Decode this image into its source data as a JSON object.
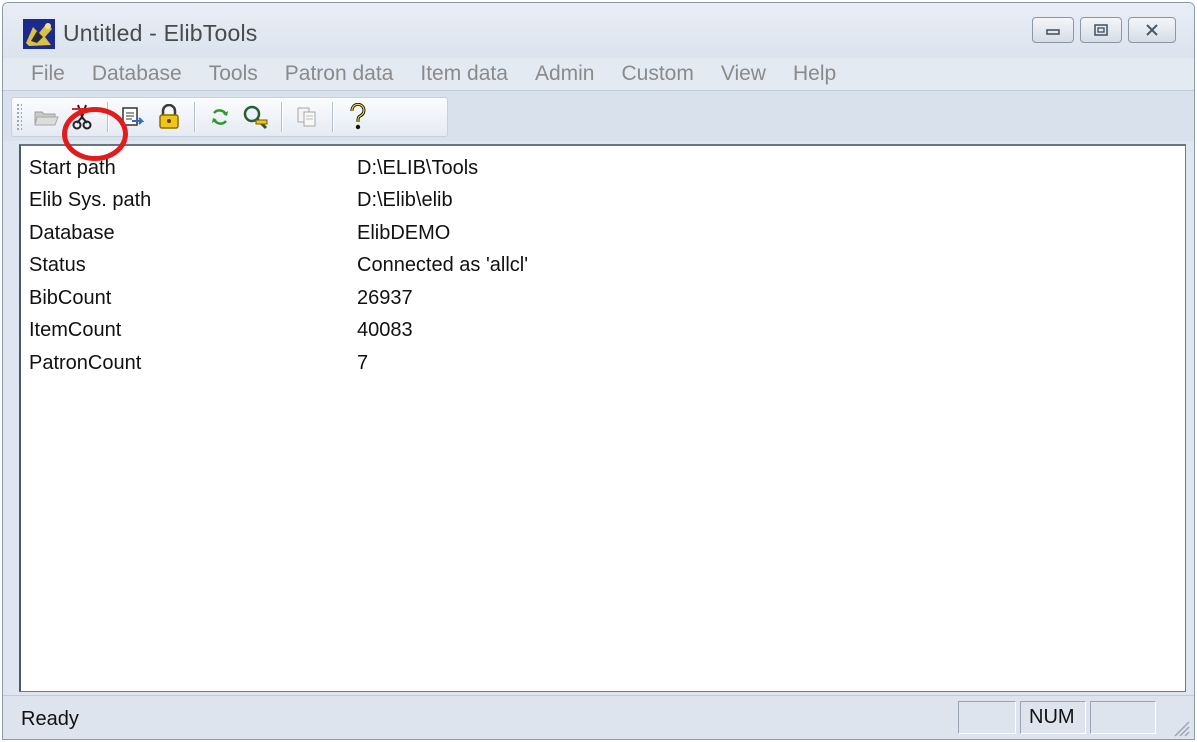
{
  "window": {
    "title": "Untitled - ElibTools",
    "icon": "elibtools-app-icon",
    "controls": [
      "minimize-icon",
      "maximize-icon",
      "close-icon"
    ]
  },
  "menu": [
    {
      "label": "File"
    },
    {
      "label": "Database"
    },
    {
      "label": "Tools"
    },
    {
      "label": "Patron data"
    },
    {
      "label": "Item data"
    },
    {
      "label": "Admin"
    },
    {
      "label": "Custom"
    },
    {
      "label": "View"
    },
    {
      "label": "Help"
    }
  ],
  "toolbar": {
    "buttons": [
      {
        "icon": "open-folder-icon",
        "enabled": false
      },
      {
        "icon": "disconnect-icon",
        "enabled": true,
        "highlighted": true
      },
      {
        "icon": "export-icon",
        "enabled": true
      },
      {
        "icon": "lock-icon",
        "enabled": true
      },
      {
        "icon": "refresh-icon",
        "enabled": true
      },
      {
        "icon": "search-keys-icon",
        "enabled": true
      },
      {
        "icon": "copy-icon",
        "enabled": false
      },
      {
        "icon": "help-icon",
        "enabled": true
      }
    ],
    "highlight_color": "#e21c1c"
  },
  "info": [
    {
      "key": "Start path",
      "value": "D:\\ELIB\\Tools"
    },
    {
      "key": "Elib Sys. path",
      "value": "D:\\Elib\\elib"
    },
    {
      "key": "Database",
      "value": "ElibDEMO"
    },
    {
      "key": "Status",
      "value": "Connected as 'allcl'"
    },
    {
      "key": "BibCount",
      "value": "26937"
    },
    {
      "key": "ItemCount",
      "value": "40083"
    },
    {
      "key": "PatronCount",
      "value": "7"
    }
  ],
  "statusbar": {
    "text": "Ready",
    "panels": [
      "",
      "NUM",
      ""
    ]
  }
}
